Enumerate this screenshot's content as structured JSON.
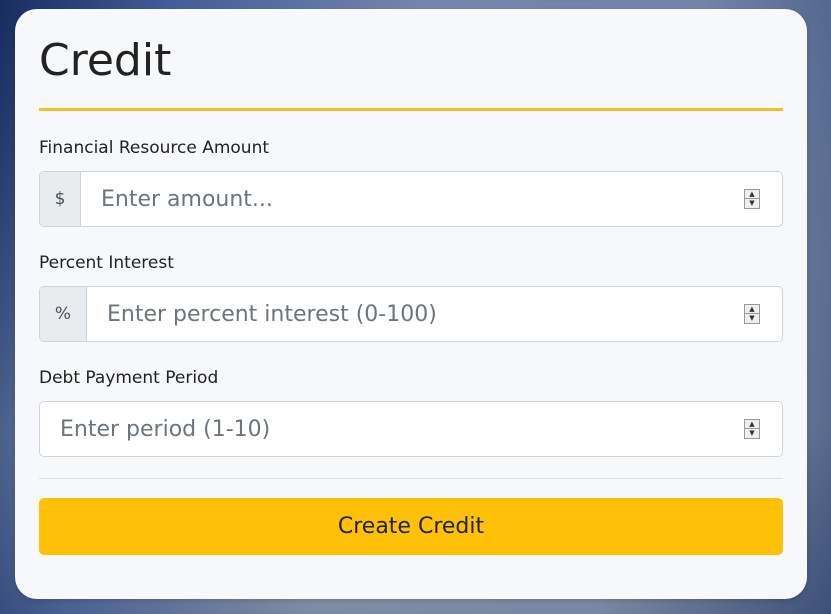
{
  "form": {
    "title": "Credit",
    "amount": {
      "label": "Financial Resource Amount",
      "addon": "$",
      "placeholder": "Enter amount..."
    },
    "interest": {
      "label": "Percent Interest",
      "addon": "%",
      "placeholder": "Enter percent interest (0-100)"
    },
    "period": {
      "label": "Debt Payment Period",
      "placeholder": "Enter period (1-10)"
    },
    "submit_label": "Create Credit"
  },
  "colors": {
    "accent": "#ffc107",
    "title_rule": "#f2c028"
  },
  "icons": {
    "spinner_up": "▲",
    "spinner_down": "▼"
  }
}
